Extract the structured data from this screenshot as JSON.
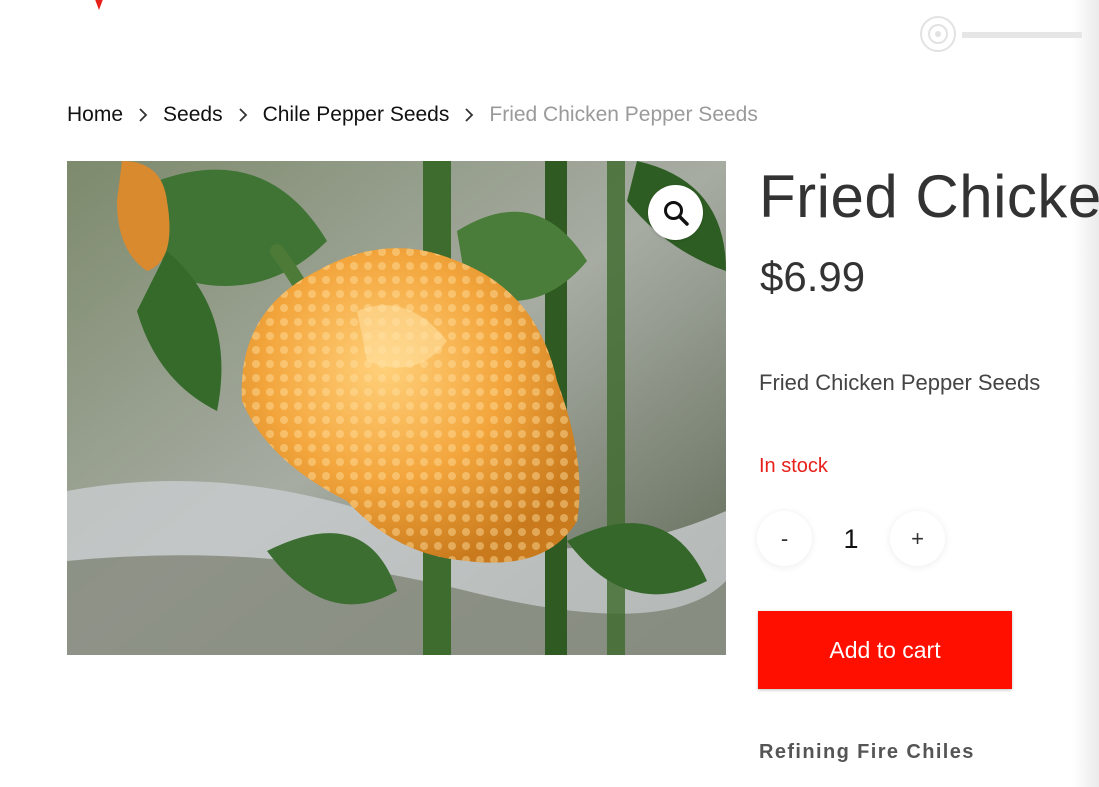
{
  "breadcrumb": {
    "items": [
      "Home",
      "Seeds",
      "Chile Pepper Seeds"
    ],
    "current": "Fried Chicken Pepper Seeds"
  },
  "product": {
    "title": "Fried Chicken",
    "price": "$6.99",
    "short_description": "Fried Chicken Pepper Seeds",
    "stock_status": "In stock",
    "quantity": "1",
    "qty_minus": "-",
    "qty_plus": "+",
    "add_to_cart": "Add to cart",
    "brand": "Refining Fire Chiles"
  },
  "icons": {
    "zoom": "magnifier-icon",
    "breadcrumb_separator": "chevron-right-icon"
  },
  "colors": {
    "accent": "#ff0f00",
    "stock": "#e8201a",
    "breadcrumb_current": "#9a9a9a",
    "text": "#333333"
  }
}
